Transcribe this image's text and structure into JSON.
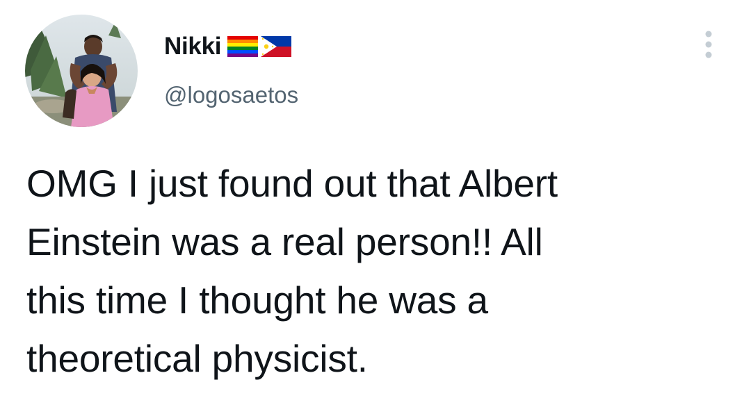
{
  "author": {
    "display_name": "Nikki",
    "handle": "@logosaetos",
    "badges": [
      "rainbow-flag-icon",
      "philippines-flag-icon"
    ]
  },
  "tweet": {
    "lines": [
      "OMG I just found out that Albert",
      "Einstein was a real person!! All",
      "this time I thought he was a",
      "theoretical physicist."
    ]
  },
  "menu": {
    "icon": "more-options-icon"
  },
  "colors": {
    "text": "#0f1419",
    "secondary_text": "#536471",
    "background": "#ffffff"
  }
}
